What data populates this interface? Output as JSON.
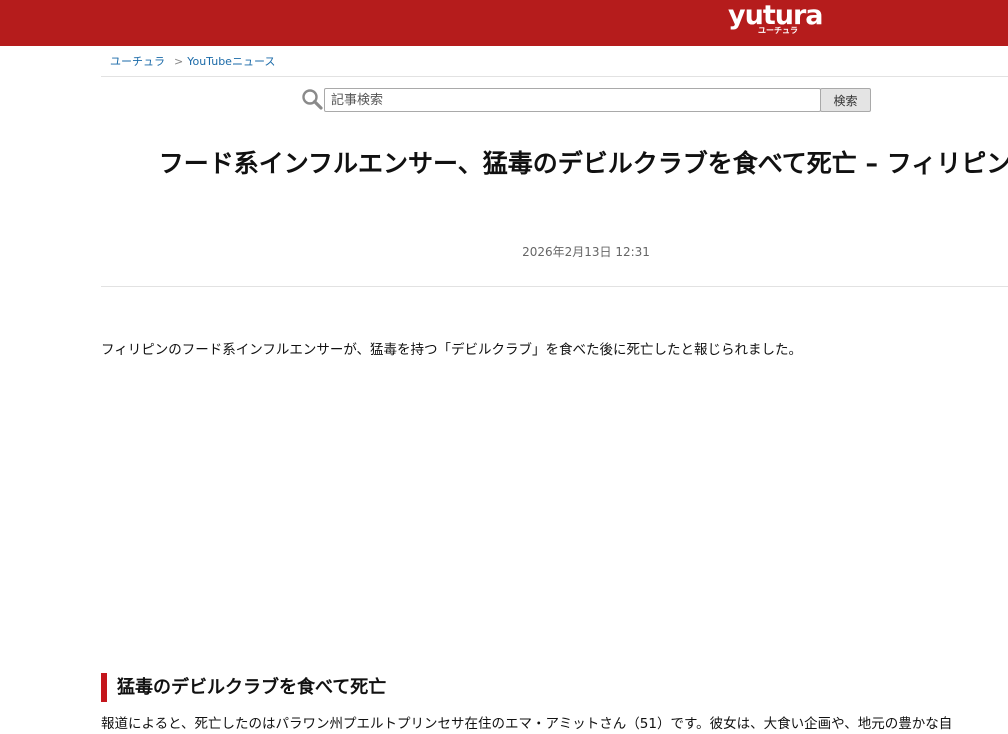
{
  "header": {
    "logo_text": "yutura",
    "logo_sub": "ユーチュラ",
    "brand_color": "#b51c1c"
  },
  "breadcrumb": {
    "items": [
      "ユーチュラ",
      "YouTubeニュース"
    ],
    "separator": ">"
  },
  "search": {
    "icon": "search-icon",
    "placeholder": "記事検索",
    "value": "",
    "button_label": "検索"
  },
  "article": {
    "title": "フード系インフルエンサー、猛毒のデビルクラブを食べて死亡 – フィリピン",
    "date": "2026年2月13日 12:31",
    "lead": "フィリピンのフード系インフルエンサーが、猛毒を持つ「デビルクラブ」を食べた後に死亡したと報じられました。",
    "section_heading": "猛毒のデビルクラブを食べて死亡",
    "accent_color": "#c4161c",
    "body": "報道によると、死亡したのはパラワン州プエルトプリンセサ在住のエマ・アミットさん（51）です。彼女は、大食い企画や、地元の豊かな自"
  }
}
